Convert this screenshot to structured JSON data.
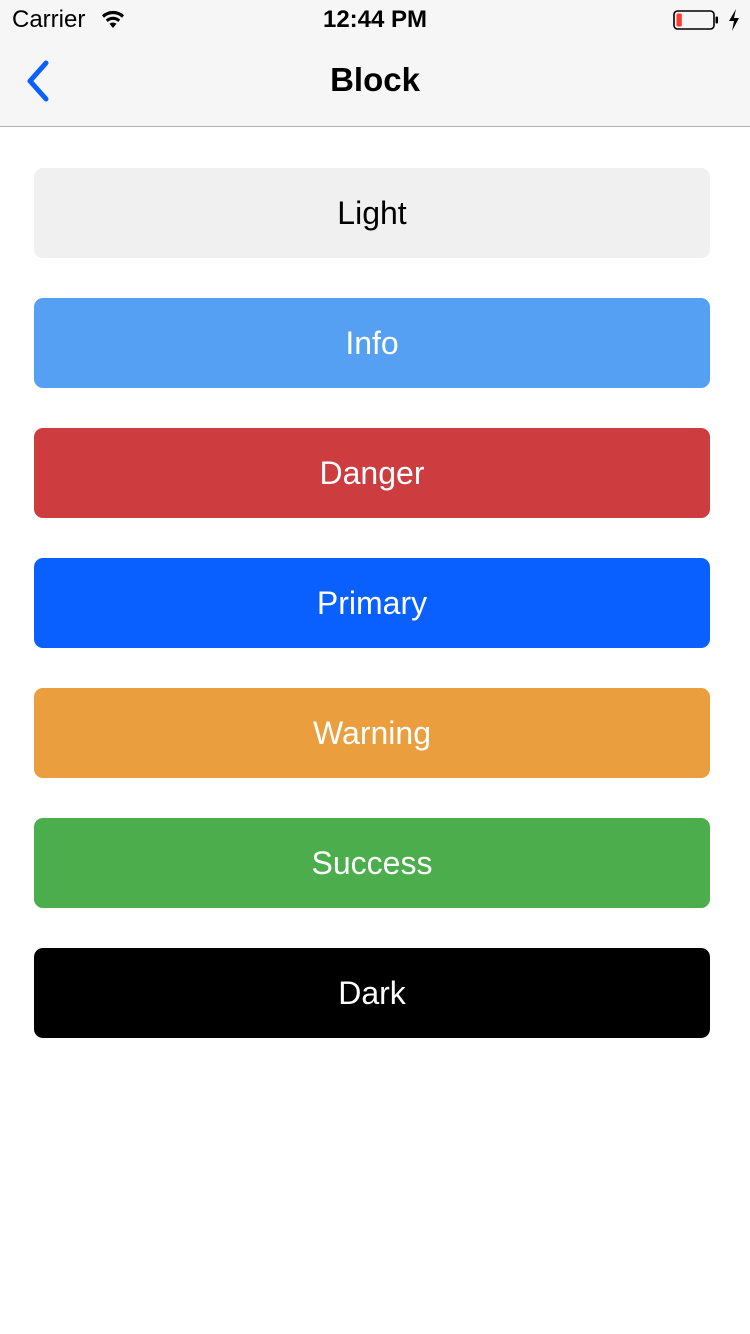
{
  "status_bar": {
    "carrier": "Carrier",
    "time": "12:44 PM",
    "wifi_icon": "wifi-icon",
    "battery_icon": "battery-low-icon",
    "charging_icon": "charging-bolt-icon",
    "battery_level": 0.15
  },
  "nav": {
    "title": "Block",
    "back_icon": "chevron-left-icon",
    "accent_color": "#0a60ff"
  },
  "buttons": [
    {
      "label": "Light",
      "bg": "#f0f0f0",
      "fg": "#000000"
    },
    {
      "label": "Info",
      "bg": "#55a0f2",
      "fg": "#ffffff"
    },
    {
      "label": "Danger",
      "bg": "#cd3c3e",
      "fg": "#ffffff"
    },
    {
      "label": "Primary",
      "bg": "#0a60ff",
      "fg": "#ffffff"
    },
    {
      "label": "Warning",
      "bg": "#ea9e3d",
      "fg": "#ffffff"
    },
    {
      "label": "Success",
      "bg": "#4cad4c",
      "fg": "#ffffff"
    },
    {
      "label": "Dark",
      "bg": "#000000",
      "fg": "#ffffff"
    }
  ]
}
